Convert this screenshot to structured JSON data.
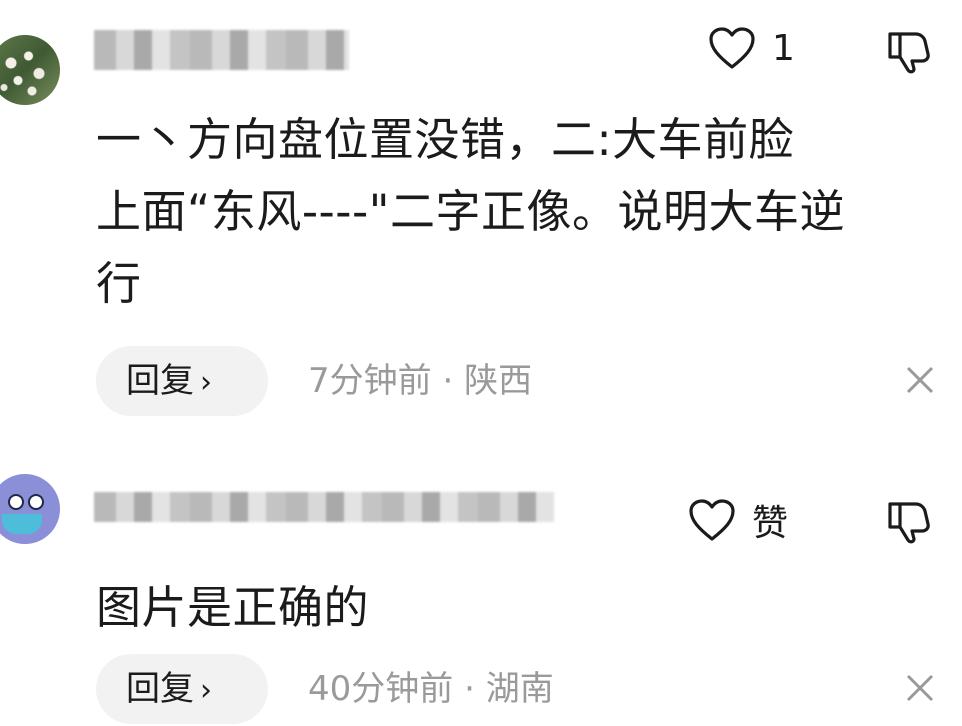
{
  "comments": [
    {
      "like_count": "1",
      "content_lines": [
        "一丶方向盘位置没错，二:大车前脸",
        "上面“东风----\"二字正像。说明大车逆",
        "行"
      ],
      "reply_label": "回复",
      "time": "7分钟前",
      "location": "陕西",
      "separator": "·"
    },
    {
      "like_count": "赞",
      "content_lines": [
        "图片是正确的"
      ],
      "reply_label": "回复",
      "time": "40分钟前",
      "location": "湖南",
      "separator": "·"
    }
  ],
  "icons": {
    "heart": "heart-icon",
    "dislike": "thumbs-down-icon",
    "close": "close-icon",
    "chevron": "›"
  }
}
